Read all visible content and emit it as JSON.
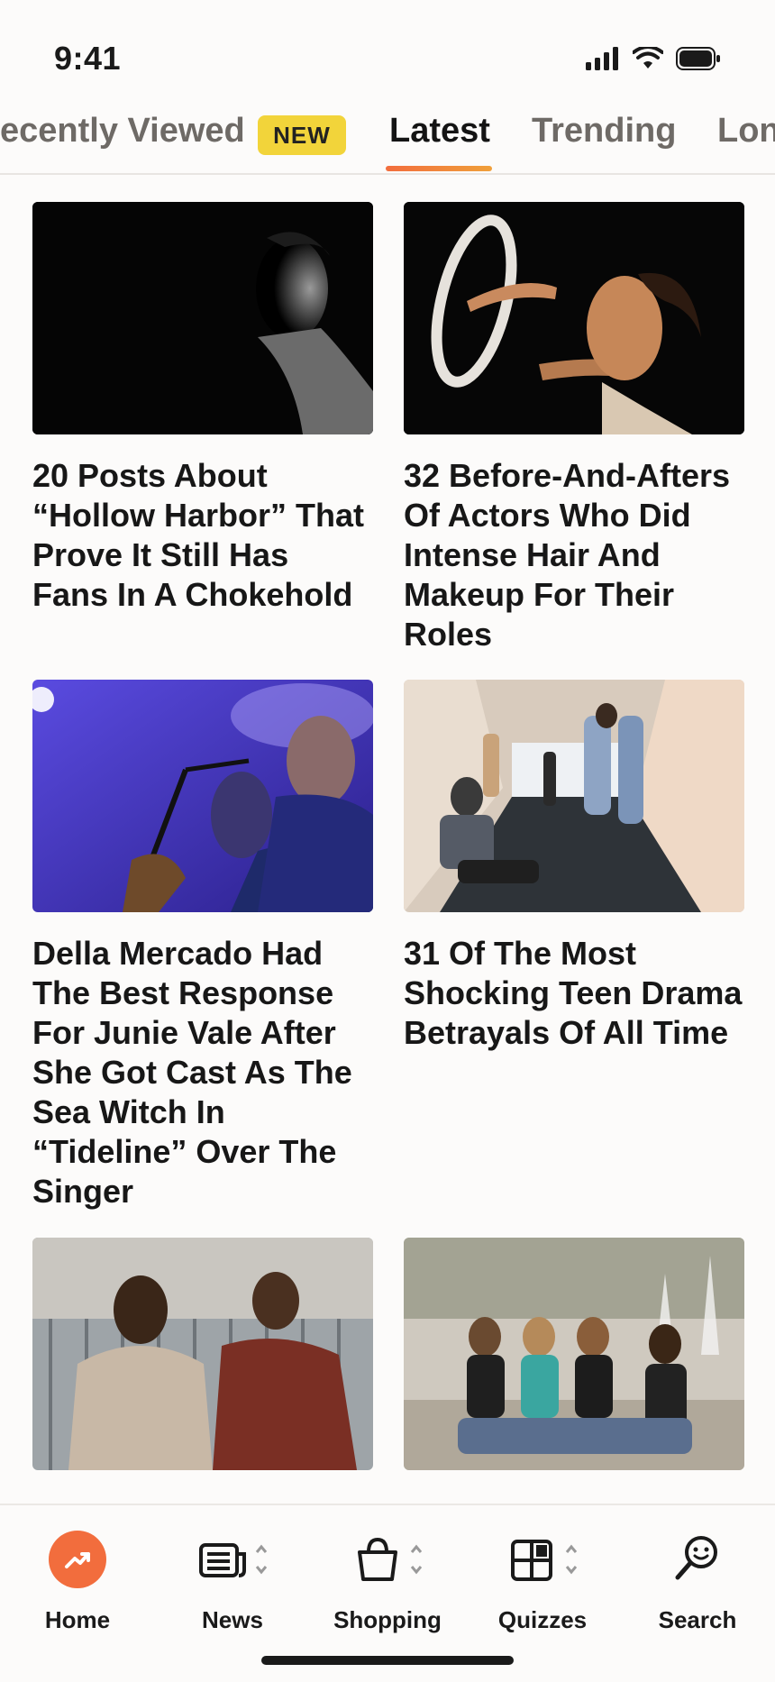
{
  "status_bar": {
    "time": "9:41"
  },
  "tabs": [
    {
      "label": "ecently Viewed"
    },
    {
      "label": "Latest",
      "active": true
    },
    {
      "label": "Trending"
    },
    {
      "label": "Lon"
    }
  ],
  "badge": "NEW",
  "articles": [
    {
      "title": "20 Posts About “Hollow Harbor” That Prove It Still Has Fans In A Chokehold"
    },
    {
      "title": "32 Before-And-Afters Of Actors Who Did Intense Hair And Makeup For Their Roles"
    },
    {
      "title": "Della Mercado Had The Best Response For Junie Vale After She Got Cast As The Sea Witch In “Tideline” Over The Singer"
    },
    {
      "title": "31 Of The Most Shocking Teen Drama Betrayals Of All Time"
    },
    {
      "title": ""
    },
    {
      "title": ""
    }
  ],
  "bottom_nav": [
    {
      "label": "Home",
      "icon": "trending-arrow-icon"
    },
    {
      "label": "News",
      "icon": "newspaper-icon"
    },
    {
      "label": "Shopping",
      "icon": "shopping-bag-icon"
    },
    {
      "label": "Quizzes",
      "icon": "quiz-grid-icon"
    },
    {
      "label": "Search",
      "icon": "search-smiley-icon"
    }
  ],
  "colors": {
    "accent": "#f26d3d",
    "badge": "#f2d43a",
    "background": "#fcfbfa"
  }
}
